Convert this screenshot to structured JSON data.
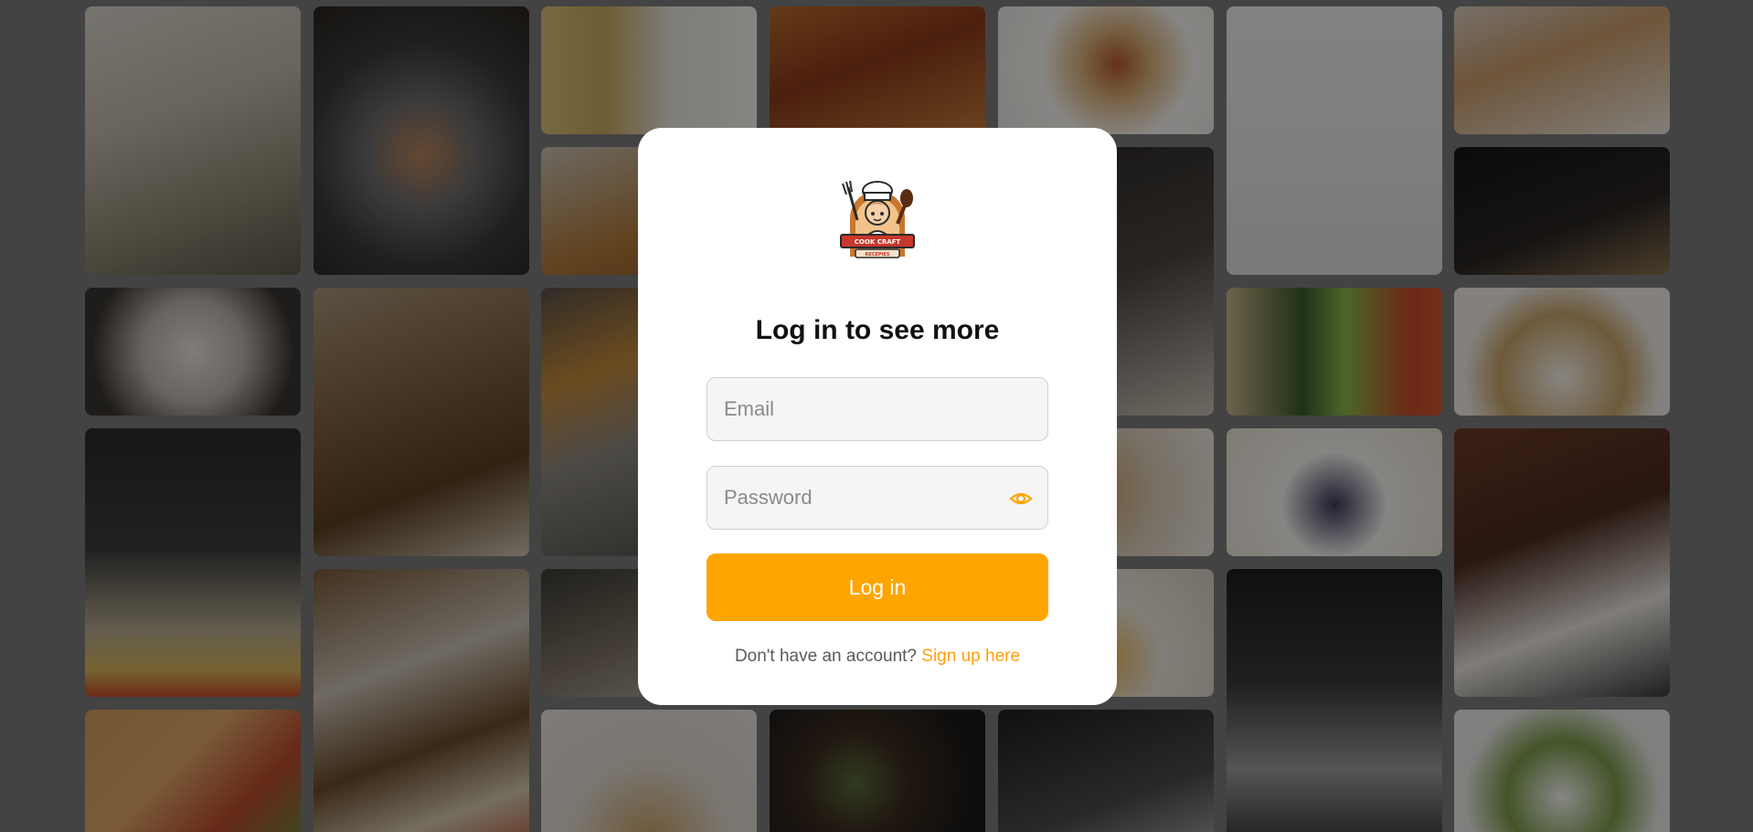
{
  "logo": {
    "brand_line": "COOK CRAFT",
    "sub_line": "RECEPIES"
  },
  "modal": {
    "title": "Log in to see more",
    "email_placeholder": "Email",
    "password_placeholder": "Password",
    "login_label": "Log in",
    "signup_prompt": "Don't have an account?",
    "signup_link": "Sign up here"
  },
  "colors": {
    "accent": "#ffa500",
    "link": "#ff9f0a"
  },
  "gallery": {
    "photos": [
      "iced-matcha-latte-cheesecake",
      "stone-bowl-salt",
      "pasta-notebook",
      "chili-spices",
      "spice-plate",
      "spoon-salt",
      "egg-hands",
      "pot-cooking",
      "knife-cutting",
      "fork-black",
      "dough-hands",
      "bread-cutting",
      "fries-tray",
      "greens-vegetables",
      "dessert-plate",
      "sifting-flour",
      "bread-loaf",
      "blueberry-cake",
      "chocolate-donuts",
      "breakfast-table",
      "kitchen-counter",
      "flour-egg",
      "flour-hands",
      "vegetables-bowls",
      "pancakes",
      "herbs-dark",
      "flour-sifter",
      "cottage-cheese-bowl"
    ]
  }
}
